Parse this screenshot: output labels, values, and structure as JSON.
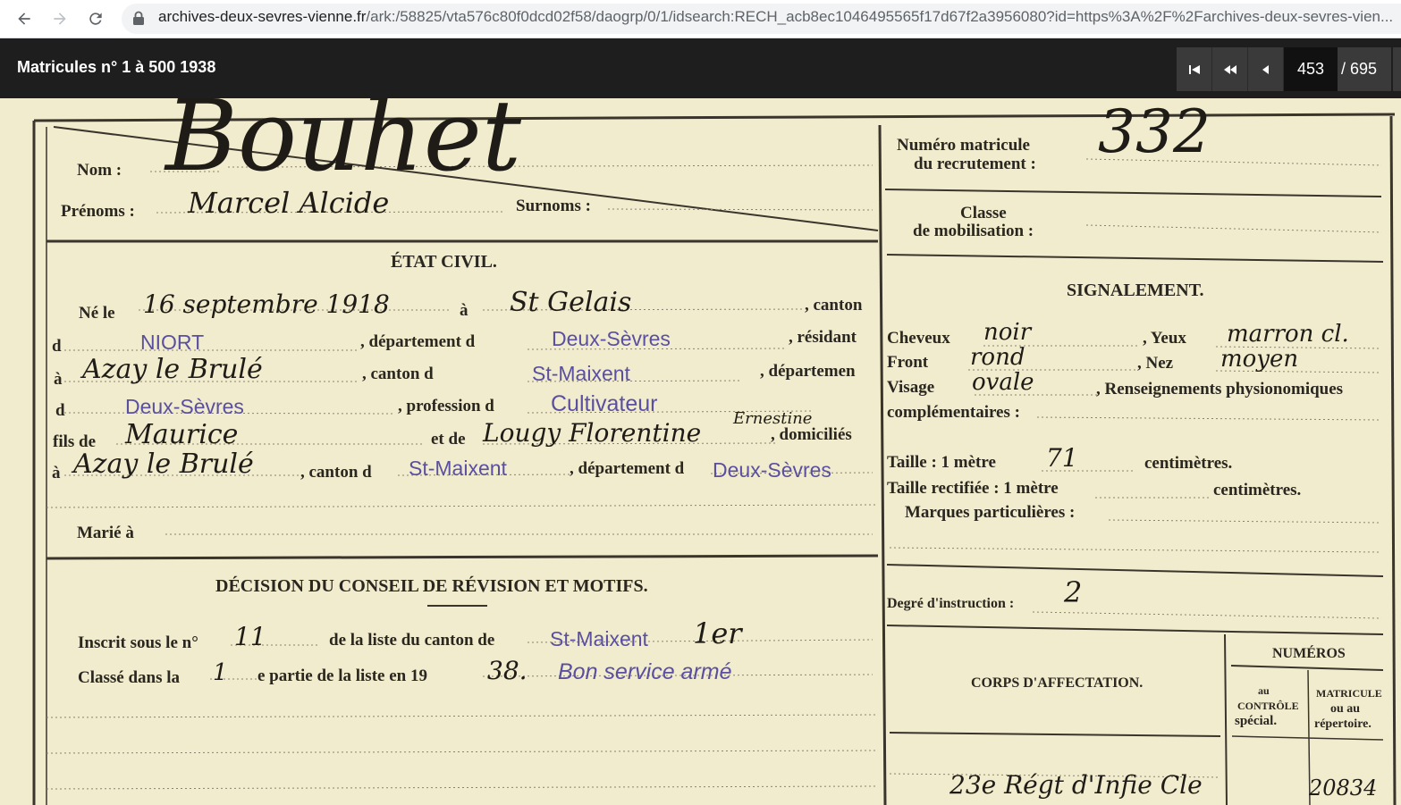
{
  "browser": {
    "url_host": "archives-deux-sevres-vienne.fr",
    "url_path": "/ark:/58825/vta576c80f0dcd02f58/daogrp/0/1/idsearch:RECH_acb8ec1046495565f17d67f2a3956080?id=https%3A%2F%2Farchives-deux-sevres-vien..."
  },
  "viewer": {
    "title": "Matricules n° 1 à 500 1938",
    "current_page": "453",
    "total_pages": "/ 695"
  },
  "document": {
    "nom_label": "Nom :",
    "nom_value": "Bouhet",
    "prenoms_label": "Prénoms :",
    "prenoms_value": "Marcel Alcide",
    "surnoms_label": "Surnoms :",
    "matricule_label_1": "Numéro matricule",
    "matricule_label_2": "du recrutement :",
    "matricule_value": "332",
    "classe_label_1": "Classe",
    "classe_label_2": "de mobilisation :",
    "etat_civil_title": "ÉTAT CIVIL.",
    "ne_le_label": "Né le",
    "ne_le_value": "16 septembre 1918",
    "a_label": "à",
    "birthplace": "St Gelais",
    "canton_label": ", canton",
    "d_label": "d",
    "canton_value": "NIORT",
    "departement_label": ", département d",
    "departement_value": "Deux-Sèvres",
    "resident_label": ", résidant",
    "residence": "Azay le Brulé",
    "canton_label_2": ", canton d",
    "canton_value_2": "St-Maixent",
    "departement_label_2": ", départemen",
    "departement_value_2": "Deux-Sèvres",
    "profession_label": ", profession d",
    "profession_value": "Cultivateur",
    "fils_label": "fils de",
    "father": "Maurice",
    "etde_label": "et de",
    "mother": "Lougy Florentine",
    "mother_extra": "Ernestine",
    "domicilies_label": ", domiciliés",
    "domicile": "Azay le Brulé",
    "canton_label_3": ", canton d",
    "canton_value_3": "St-Maixent",
    "departement_label_3": ", département d",
    "departement_value_3": "Deux-Sèvres",
    "marie_label": "Marié à",
    "signalement_title": "SIGNALEMENT.",
    "cheveux_label": "Cheveux",
    "cheveux_value": "noir",
    "yeux_label": ", Yeux",
    "yeux_value": "marron cl.",
    "front_label": "Front",
    "front_value": "rond",
    "nez_label": ", Nez",
    "nez_value": "moyen",
    "visage_label": "Visage",
    "visage_value": "ovale",
    "renseignements_label": ", Renseignements physionomiques",
    "complementaires_label": "complémentaires :",
    "taille_label": "Taille : 1 mètre",
    "taille_value": "71",
    "centimetres_label": "centimètres.",
    "taille_rect_label": "Taille rectifiée : 1 mètre",
    "centimetres_label_2": "centimètres.",
    "marques_label": "Marques particulières :",
    "degre_label": "Degré d'instruction :",
    "degre_value": "2",
    "decision_title": "DÉCISION DU CONSEIL DE RÉVISION ET MOTIFS.",
    "inscrit_label": "Inscrit sous le n°",
    "inscrit_value": "11",
    "liste_label": "de la liste du canton de",
    "liste_value": "St-Maixent",
    "liste_extra": "1er",
    "classe_dans_label": "Classé dans la",
    "classe_dans_value": "1",
    "partie_label": "e partie de la liste en 19",
    "annee_value": "38.",
    "bon_service": "Bon service armé",
    "corps_title": "CORPS D'AFFECTATION.",
    "numeros_title": "NUMÉROS",
    "controle_1": "au",
    "controle_2": "CONTRÔLE",
    "controle_3": "spécial.",
    "matricule_col_1": "MATRICULE",
    "matricule_col_2": "ou au",
    "matricule_col_3": "répertoire.",
    "corps_value": "23e Régt d'Infie Cle",
    "corps_matricule": "20834"
  }
}
